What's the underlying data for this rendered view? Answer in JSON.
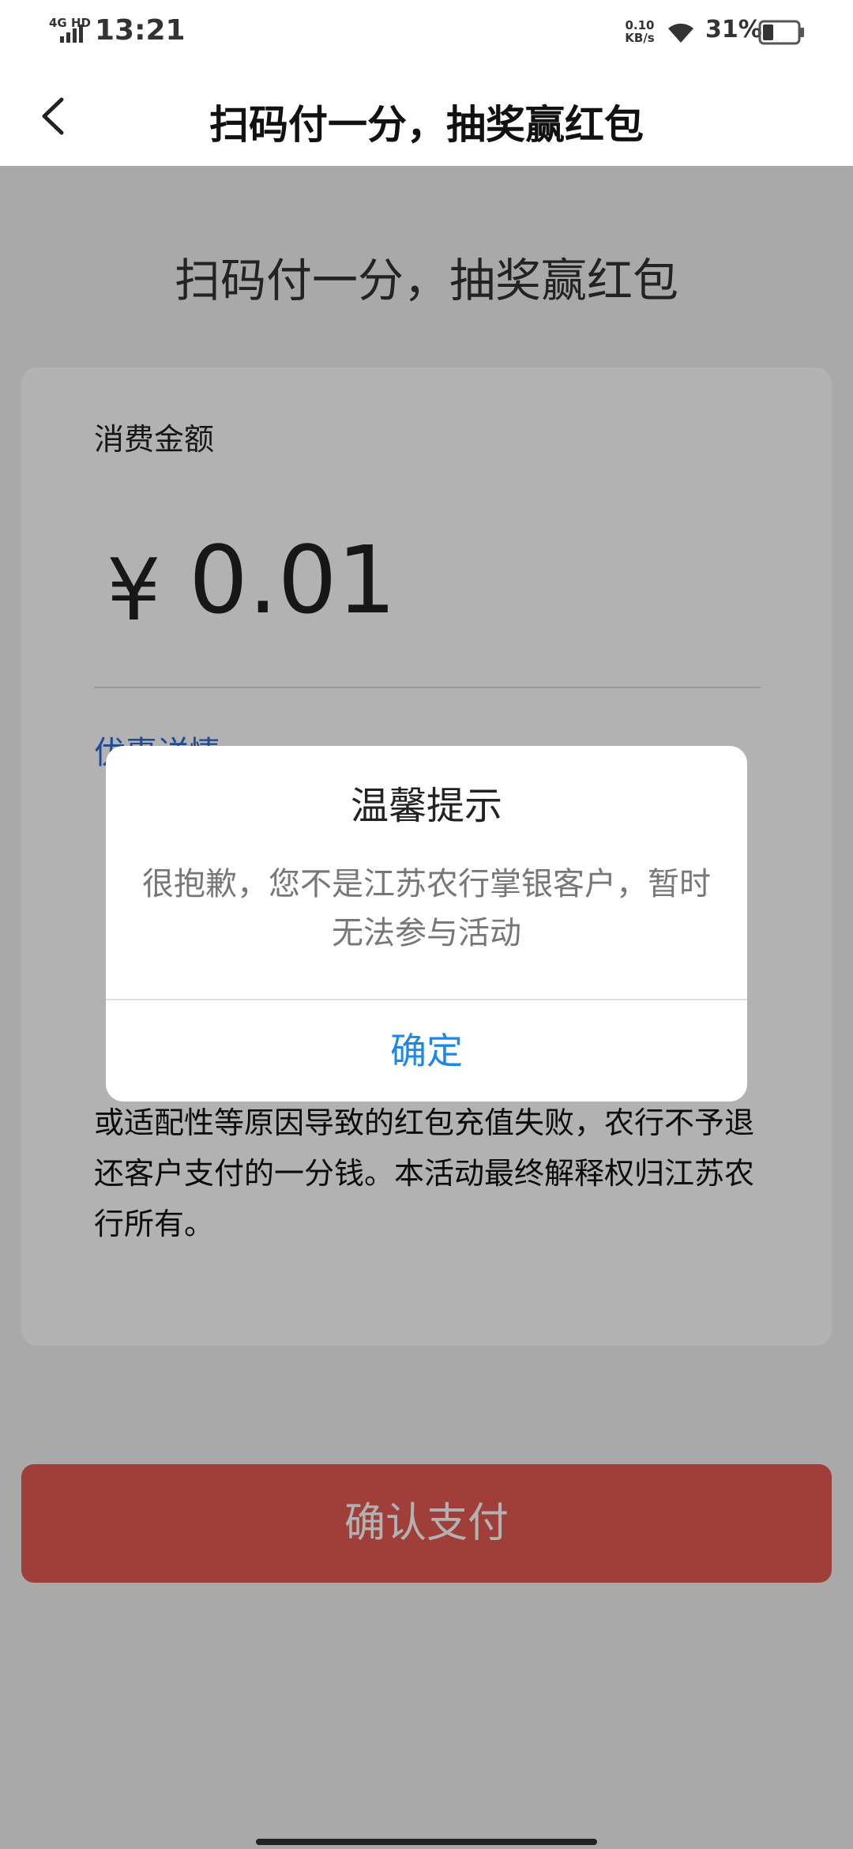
{
  "status_bar": {
    "network": "4G HD",
    "time": "13:21",
    "speed_value": "0.10",
    "speed_unit": "KB/s",
    "battery": "31%",
    "battery_level": 0.31,
    "icons": [
      "signal-icon",
      "wifi-icon",
      "battery-icon"
    ]
  },
  "nav": {
    "title": "扫码付一分，抽奖赢红包",
    "back_icon": "chevron-left-icon"
  },
  "main": {
    "heading": "扫码付一分，抽奖赢红包",
    "amount_label": "消费金额",
    "currency_symbol": "¥",
    "amount": "0.01",
    "promo_title": "优惠详情",
    "promo_text": "或适配性等原因导致的红包充值失败，农行不予退还客户支付的一分钱。本活动最终解释权归江苏农行所有。",
    "pay_button": "确认支付"
  },
  "dialog": {
    "title": "温馨提示",
    "message": "很抱歉，您不是江苏农行掌银客户，暂时无法参与活动",
    "confirm": "确定"
  },
  "colors": {
    "link": "#2b6cd4",
    "pay_button": "#e55b54",
    "dialog_button": "#1e88e5",
    "overlay": "rgba(0,0,0,0.30)"
  }
}
